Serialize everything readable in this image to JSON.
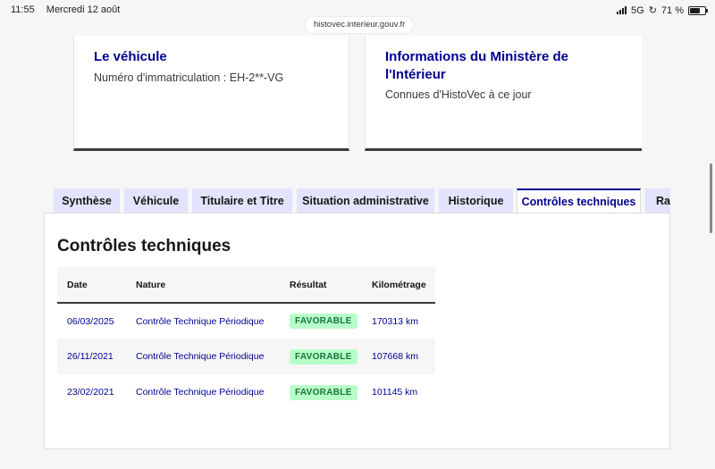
{
  "status_bar": {
    "time": "11:55",
    "date": "Mercredi 12 août",
    "network": "5G",
    "battery": "71 %"
  },
  "browser": {
    "url": "histovec.interieur.gouv.fr"
  },
  "cards": {
    "vehicle": {
      "title": "Le véhicule",
      "text": "Numéro d'immatriculation : EH-2**-VG"
    },
    "ministry": {
      "title": "Informations du Ministère de l'Intérieur",
      "text": "Connues d'HistoVec à ce jour"
    }
  },
  "tabs": [
    {
      "label": "Synthèse"
    },
    {
      "label": "Véhicule"
    },
    {
      "label": "Titulaire et Titre"
    },
    {
      "label": "Situation administrative"
    },
    {
      "label": "Historique"
    },
    {
      "label": "Contrôles techniques"
    },
    {
      "label": "Rap"
    }
  ],
  "active_tab": "Contrôles techniques",
  "panel": {
    "title": "Contrôles techniques",
    "columns": [
      "Date",
      "Nature",
      "Résultat",
      "Kilométrage"
    ],
    "rows": [
      {
        "date": "06/03/2025",
        "nature": "Contrôle Technique Périodique",
        "result": "FAVORABLE",
        "km": "170313 km"
      },
      {
        "date": "26/11/2021",
        "nature": "Contrôle Technique Périodique",
        "result": "FAVORABLE",
        "km": "107668 km"
      },
      {
        "date": "23/02/2021",
        "nature": "Contrôle Technique Périodique",
        "result": "FAVORABLE",
        "km": "101145 km"
      }
    ]
  },
  "colors": {
    "accent": "#000091",
    "tab_bg": "#e3e3fd",
    "badge_bg": "#b8fec9",
    "badge_text": "#18753c"
  }
}
